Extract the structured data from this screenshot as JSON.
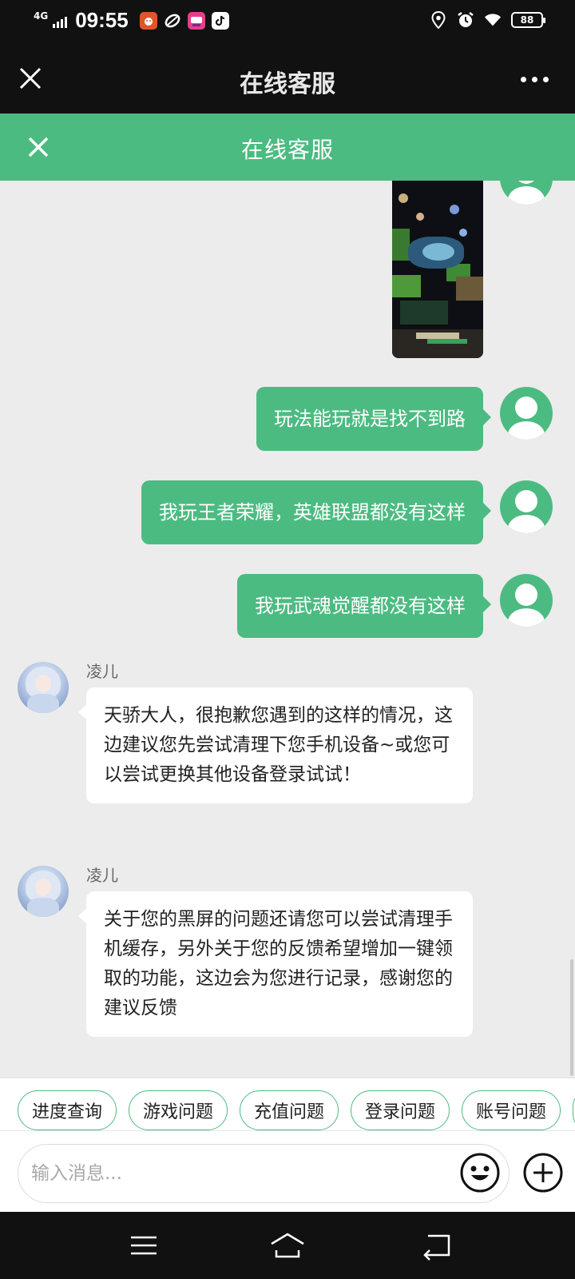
{
  "status_bar": {
    "network": "4G",
    "time": "09:55",
    "battery": "88",
    "app_icons": [
      "app-red-icon",
      "app-leaf-icon",
      "app-pink-icon",
      "app-tiktok-icon"
    ],
    "colors": {
      "bg": "#111111"
    }
  },
  "nav": {
    "title": "在线客服",
    "close_icon": "close-icon",
    "more_icon": "more-icon"
  },
  "header": {
    "title": "在线客服",
    "close_icon": "close-icon",
    "color": "#4cbb82"
  },
  "messages": [
    {
      "type": "image",
      "from": "user",
      "description_icon": "game-screenshot-image"
    },
    {
      "type": "text",
      "from": "user",
      "text": "玩法能玩就是找不到路"
    },
    {
      "type": "text",
      "from": "user",
      "text": "我玩王者荣耀，英雄联盟都没有这样"
    },
    {
      "type": "text",
      "from": "user",
      "text": "我玩武魂觉醒都没有这样"
    },
    {
      "type": "text",
      "from": "agent",
      "name": "凌儿",
      "text": "天骄大人，很抱歉您遇到的这样的情况，这边建议您先尝试清理下您手机设备~或您可以尝试更换其他设备登录试试！"
    },
    {
      "type": "text",
      "from": "agent",
      "name": "凌儿",
      "text": "关于您的黑屏的问题还请您可以尝试清理手机缓存，另外关于您的反馈希望增加一键领取的功能，这边会为您进行记录，感谢您的建议反馈"
    }
  ],
  "quick_replies": [
    "进度查询",
    "游戏问题",
    "充值问题",
    "登录问题",
    "账号问题"
  ],
  "input": {
    "placeholder": "输入消息...",
    "value": "",
    "emoji_icon": "emoji-icon",
    "plus_icon": "plus-icon"
  },
  "system_nav": {
    "icons": [
      "menu-icon",
      "home-icon",
      "back-icon"
    ]
  }
}
